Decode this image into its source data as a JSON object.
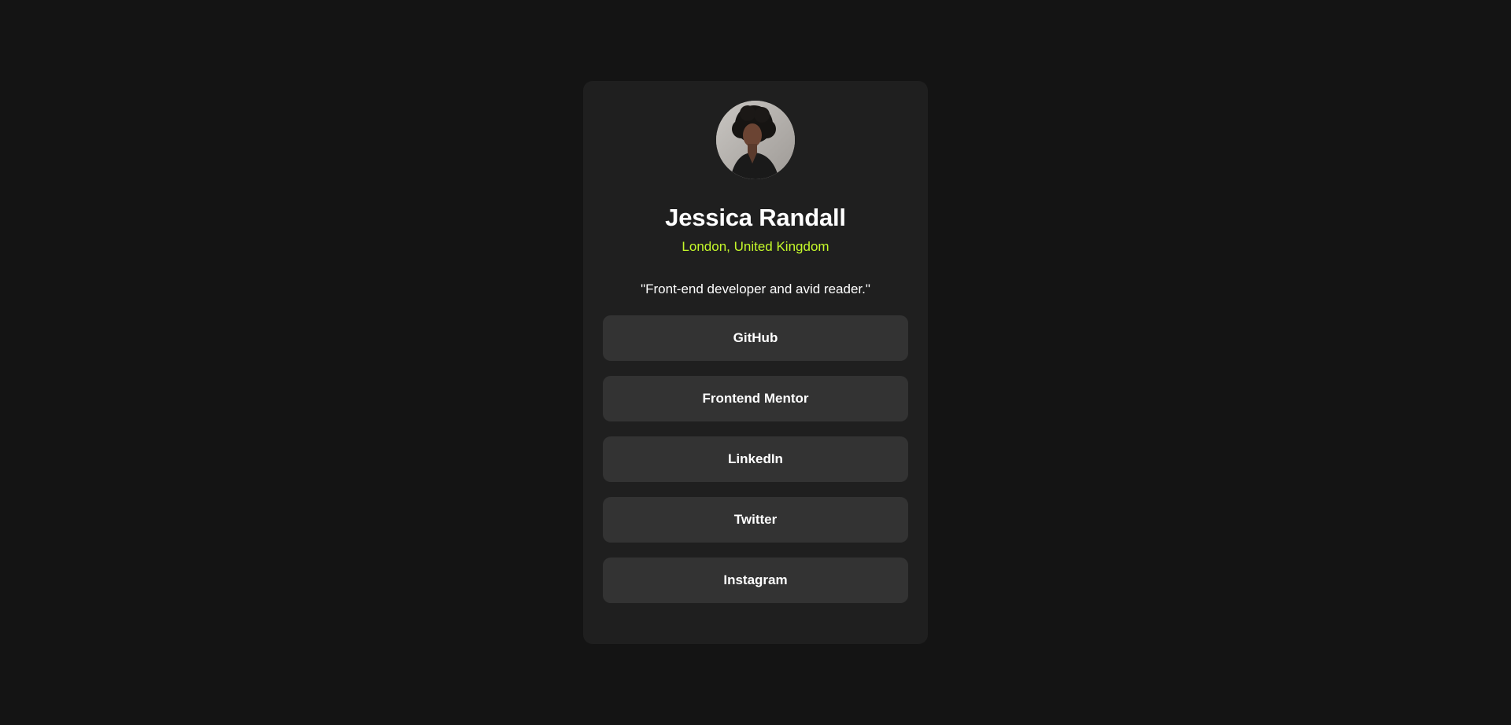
{
  "profile": {
    "name": "Jessica Randall",
    "location": "London, United Kingdom",
    "bio": "\"Front-end developer and avid reader.\"",
    "avatar_icon": "profile-photo"
  },
  "links": [
    {
      "label": "GitHub"
    },
    {
      "label": "Frontend Mentor"
    },
    {
      "label": "LinkedIn"
    },
    {
      "label": "Twitter"
    },
    {
      "label": "Instagram"
    }
  ],
  "colors": {
    "page_background": "#141414",
    "card_background": "#1f1f1f",
    "button_background": "#333333",
    "accent": "#c4f82a",
    "text": "#ffffff"
  }
}
